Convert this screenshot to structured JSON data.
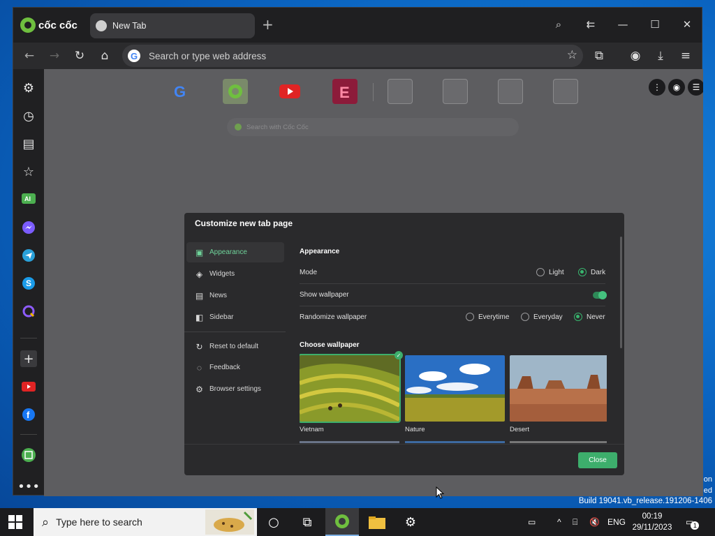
{
  "browser": {
    "brand": "cốc cốc",
    "tab_title": "New Tab",
    "new_tab_symbol": "+",
    "omnibox_placeholder": "Search or type web address"
  },
  "ntp": {
    "search_placeholder": "Search with Cốc Cốc",
    "shortcuts": [
      "Google",
      "Cốc Cốc",
      "YouTube",
      "E"
    ]
  },
  "dialog": {
    "title": "Customize new tab page",
    "nav": [
      {
        "label": "Appearance",
        "icon": "image-icon"
      },
      {
        "label": "Widgets",
        "icon": "layers-icon"
      },
      {
        "label": "News",
        "icon": "newspaper-icon"
      },
      {
        "label": "Sidebar",
        "icon": "sidebar-icon"
      },
      {
        "label": "Reset to default",
        "icon": "reset-icon"
      },
      {
        "label": "Feedback",
        "icon": "chat-icon"
      },
      {
        "label": "Browser settings",
        "icon": "gear-icon"
      }
    ],
    "appearance_title": "Appearance",
    "mode_label": "Mode",
    "mode_options": [
      "Light",
      "Dark"
    ],
    "mode_selected": "Dark",
    "show_wallpaper_label": "Show wallpaper",
    "show_wallpaper_on": true,
    "randomize_label": "Randomize wallpaper",
    "randomize_options": [
      "Everytime",
      "Everyday",
      "Never"
    ],
    "randomize_selected": "Never",
    "choose_wallpaper_title": "Choose wallpaper",
    "wallpapers": [
      "Vietnam",
      "Nature",
      "Desert"
    ],
    "selected_wallpaper": "Vietnam",
    "close_label": "Close",
    "accent_color": "#3dae6c"
  },
  "desktop": {
    "build_text": "Build 19041.vb_release.191206-1406",
    "edge_text_1": "on",
    "edge_text_2": "ed"
  },
  "taskbar": {
    "search_placeholder": "Type here to search",
    "language": "ENG",
    "time": "00:19",
    "date": "29/11/2023",
    "notification_count": "1"
  }
}
